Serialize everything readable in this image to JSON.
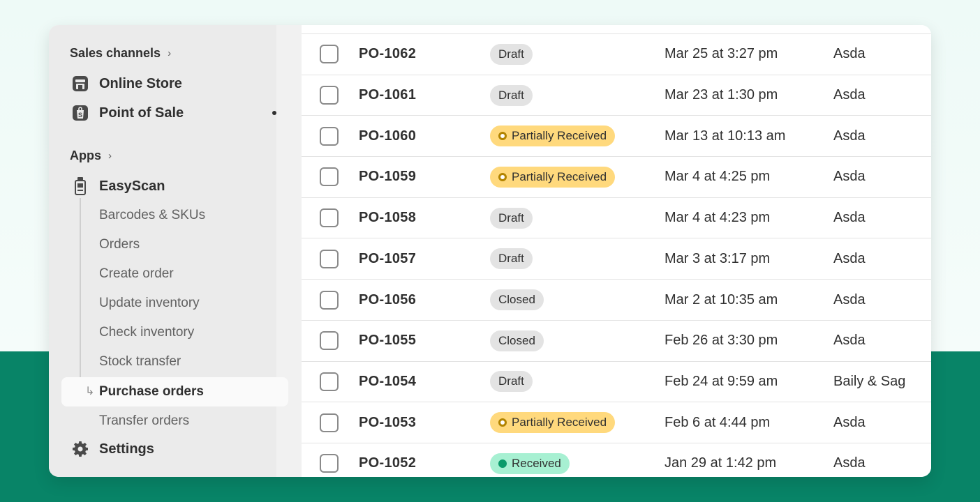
{
  "sidebar": {
    "sales_channels_label": "Sales channels",
    "channels": [
      {
        "label": "Online Store",
        "icon": "store-icon"
      },
      {
        "label": "Point of Sale",
        "icon": "pos-bag-icon"
      }
    ],
    "apps_label": "Apps",
    "app": {
      "label": "EasyScan",
      "icon": "scanner-icon"
    },
    "sub_items": [
      {
        "label": "Barcodes & SKUs"
      },
      {
        "label": "Orders"
      },
      {
        "label": "Create order"
      },
      {
        "label": "Update inventory"
      },
      {
        "label": "Check inventory"
      },
      {
        "label": "Stock transfer"
      },
      {
        "label": "Purchase orders",
        "active": true
      },
      {
        "label": "Transfer orders"
      }
    ],
    "settings_label": "Settings"
  },
  "orders": [
    {
      "id": "PO-1062",
      "status": "Draft",
      "status_type": "draft",
      "date": "Mar 25 at 3:27 pm",
      "supplier": "Asda"
    },
    {
      "id": "PO-1061",
      "status": "Draft",
      "status_type": "draft",
      "date": "Mar 23 at 1:30 pm",
      "supplier": "Asda"
    },
    {
      "id": "PO-1060",
      "status": "Partially Received",
      "status_type": "partial",
      "date": "Mar 13 at 10:13 am",
      "supplier": "Asda"
    },
    {
      "id": "PO-1059",
      "status": "Partially Received",
      "status_type": "partial",
      "date": "Mar 4 at 4:25 pm",
      "supplier": "Asda"
    },
    {
      "id": "PO-1058",
      "status": "Draft",
      "status_type": "draft",
      "date": "Mar 4 at 4:23 pm",
      "supplier": "Asda"
    },
    {
      "id": "PO-1057",
      "status": "Draft",
      "status_type": "draft",
      "date": "Mar 3 at 3:17 pm",
      "supplier": "Asda"
    },
    {
      "id": "PO-1056",
      "status": "Closed",
      "status_type": "closed",
      "date": "Mar 2 at 10:35 am",
      "supplier": "Asda"
    },
    {
      "id": "PO-1055",
      "status": "Closed",
      "status_type": "closed",
      "date": "Feb 26 at 3:30 pm",
      "supplier": "Asda"
    },
    {
      "id": "PO-1054",
      "status": "Draft",
      "status_type": "draft",
      "date": "Feb 24 at 9:59 am",
      "supplier": "Baily & Sag"
    },
    {
      "id": "PO-1053",
      "status": "Partially Received",
      "status_type": "partial",
      "date": "Feb 6 at 4:44 pm",
      "supplier": "Asda"
    },
    {
      "id": "PO-1052",
      "status": "Received",
      "status_type": "received",
      "date": "Jan 29 at 1:42 pm",
      "supplier": "Asda"
    }
  ]
}
